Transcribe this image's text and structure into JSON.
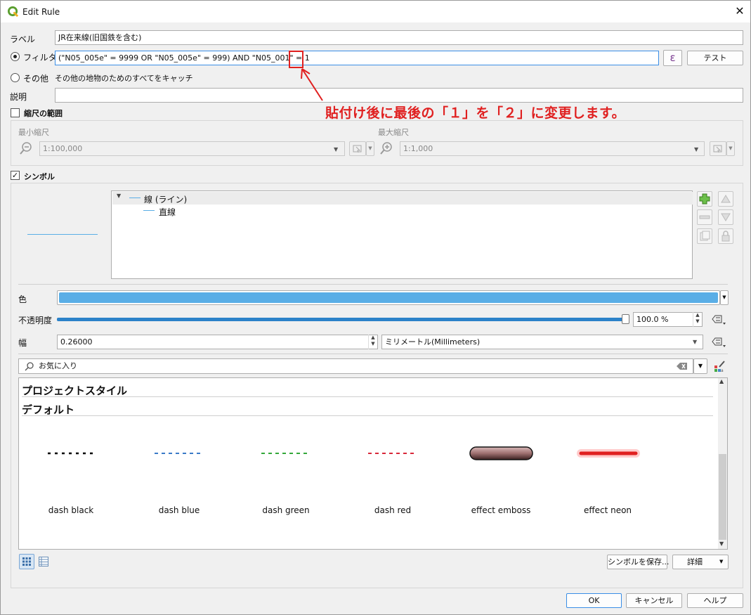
{
  "window": {
    "title": "Edit Rule",
    "close_glyph": "✕"
  },
  "label_row": {
    "label": "ラベル",
    "value": "JR在来線(旧国鉄を含む)"
  },
  "filter_row": {
    "label": "フィルタ",
    "value": "(\"N05_005e\" = 9999  OR \"N05_005e\" = 999) AND \"N05_001\" = 1",
    "expr_button": "ε",
    "test_button": "テスト"
  },
  "else_row": {
    "label": "その他",
    "desc": "その他の地物のためのすべてをキャッチ"
  },
  "desc_row": {
    "label": "説明",
    "value": ""
  },
  "scale": {
    "title": "縮尺の範囲",
    "checked": false,
    "min_label": "最小縮尺",
    "min_value": "1:100,000",
    "max_label": "最大縮尺",
    "max_value": "1:1,000"
  },
  "symbol": {
    "title": "シンボル",
    "checked": true,
    "tree": [
      {
        "label": "線 (ライン)"
      },
      {
        "label": "直線"
      }
    ],
    "color_label": "色",
    "color_value": "#5aaee6",
    "opacity_label": "不透明度",
    "opacity_value": "100.0 %",
    "opacity_fraction": 1.0,
    "width_label": "幅",
    "width_value": "0.26000",
    "unit_value": "ミリメートル(Millimeters)"
  },
  "library": {
    "search_placeholder": "お気に入り",
    "sections": [
      "プロジェクトスタイル",
      "デフォルト"
    ],
    "symbols": [
      {
        "name": "dash  black",
        "color": "#000000"
      },
      {
        "name": "dash blue",
        "color": "#3a7ac8"
      },
      {
        "name": "dash green",
        "color": "#34a83a"
      },
      {
        "name": "dash red",
        "color": "#d8283a"
      },
      {
        "name": "effect emboss",
        "color": "#a07878"
      },
      {
        "name": "effect neon",
        "color": "#e02020"
      }
    ],
    "save_button": "シンボルを保存...",
    "advanced_button": "詳細"
  },
  "buttons": {
    "ok": "OK",
    "cancel": "キャンセル",
    "help": "ヘルプ"
  },
  "annotation": {
    "text": "貼付け後に最後の「１」を「２」に変更します。",
    "color": "#e02020"
  }
}
